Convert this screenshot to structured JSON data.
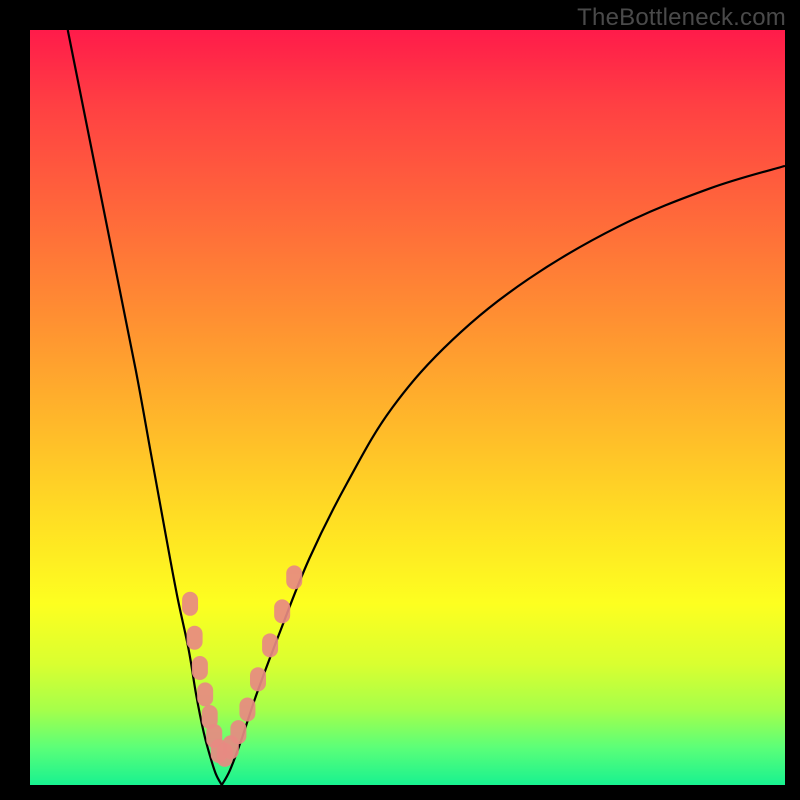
{
  "attribution": "TheBottleneck.com",
  "chart_data": {
    "type": "line",
    "title": "",
    "xlabel": "",
    "ylabel": "",
    "xlim": [
      0,
      100
    ],
    "ylim": [
      0,
      100
    ],
    "series": [
      {
        "name": "left-branch",
        "x": [
          5,
          8,
          11,
          14,
          16,
          18,
          19.5,
          21,
          22,
          23,
          23.8,
          24.6,
          25.4
        ],
        "values": [
          100,
          85,
          70,
          55,
          44,
          33,
          25,
          18,
          12,
          7,
          4,
          1.5,
          0
        ]
      },
      {
        "name": "right-branch",
        "x": [
          25.4,
          26.5,
          28,
          30,
          33,
          37,
          42,
          48,
          56,
          66,
          78,
          90,
          100
        ],
        "values": [
          0,
          2,
          6,
          12,
          20,
          30,
          40,
          50,
          59,
          67,
          74,
          79,
          82
        ]
      }
    ],
    "markers": {
      "name": "highlighted-points",
      "x": [
        21.2,
        21.8,
        22.5,
        23.2,
        23.8,
        24.4,
        25.0,
        25.8,
        26.6,
        27.6,
        28.8,
        30.2,
        31.8,
        33.4,
        35.0
      ],
      "values": [
        24,
        19.5,
        15.5,
        12,
        9,
        6.5,
        4.5,
        4,
        5,
        7,
        10,
        14,
        18.5,
        23,
        27.5
      ]
    },
    "background_gradient": {
      "top": "#ff1b4a",
      "mid_upper": "#ff8f32",
      "mid": "#ffe223",
      "mid_lower": "#a6ff4a",
      "bottom": "#18f290"
    }
  }
}
